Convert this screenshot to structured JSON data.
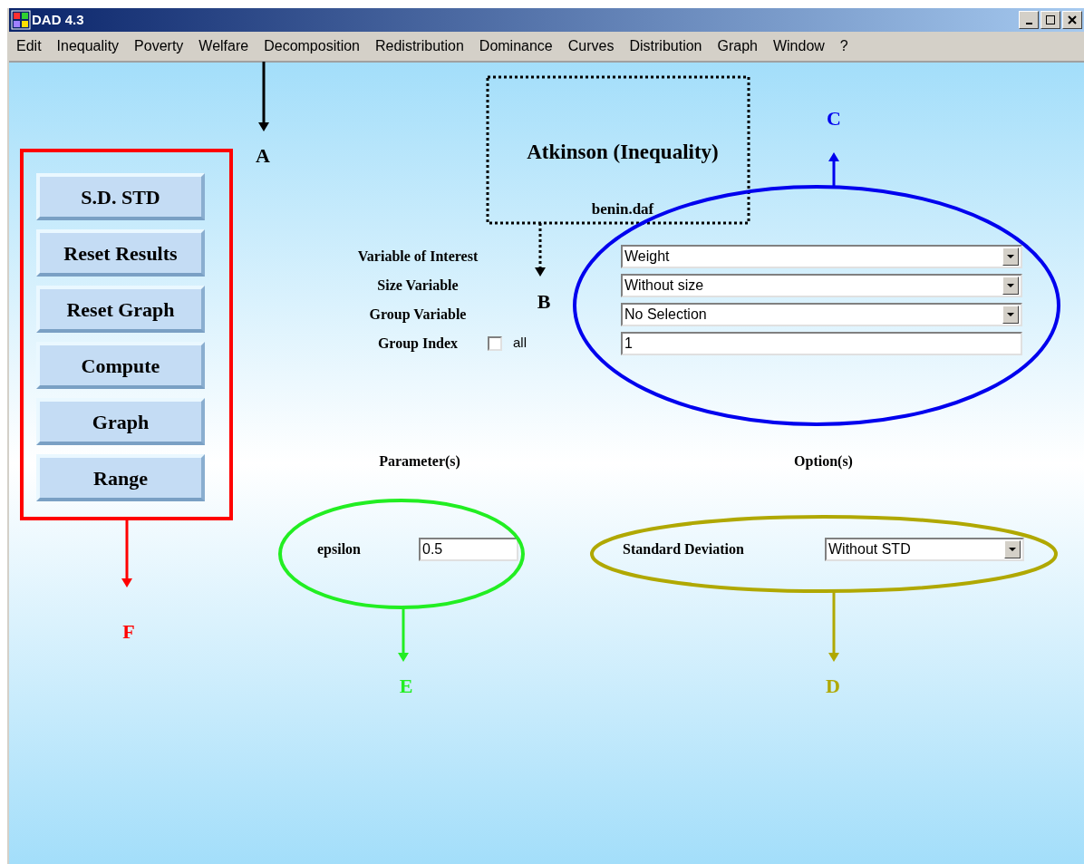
{
  "window": {
    "title": "DAD 4.3"
  },
  "menu": [
    "Edit",
    "Inequality",
    "Poverty",
    "Welfare",
    "Decomposition",
    "Redistribution",
    "Dominance",
    "Curves",
    "Distribution",
    "Graph",
    "Window",
    "?"
  ],
  "buttons": [
    "S.D. STD",
    "Reset Results",
    "Reset Graph",
    "Compute",
    "Graph",
    "Range"
  ],
  "heading": {
    "title": "Atkinson (Inequality)",
    "file": "benin.daf"
  },
  "fields": [
    {
      "label": "Variable of Interest",
      "kind": "dropdown",
      "value": "Weight"
    },
    {
      "label": "Size Variable",
      "kind": "dropdown",
      "value": "Without size"
    },
    {
      "label": "Group Variable",
      "kind": "dropdown",
      "value": "No Selection"
    },
    {
      "label": "Group Index",
      "kind": "text",
      "value": "1",
      "checkbox": {
        "label": "all",
        "checked": false
      }
    }
  ],
  "parameters": {
    "heading": "Parameter(s)",
    "label": "epsilon",
    "value": "0.5"
  },
  "options": {
    "heading": "Option(s)",
    "label": "Standard Deviation",
    "value": "Without STD"
  },
  "annotations": [
    {
      "label": "A",
      "kind": "arrow",
      "color": "#000000"
    },
    {
      "label": "B",
      "kind": "dotted-box",
      "color": "#000000"
    },
    {
      "label": "C",
      "kind": "ellipse",
      "color": "#0000ee"
    },
    {
      "label": "D",
      "kind": "ellipse",
      "color": "#b0a800"
    },
    {
      "label": "E",
      "kind": "ellipse",
      "color": "#22ee22"
    },
    {
      "label": "F",
      "kind": "box",
      "color": "#ff0000"
    }
  ]
}
